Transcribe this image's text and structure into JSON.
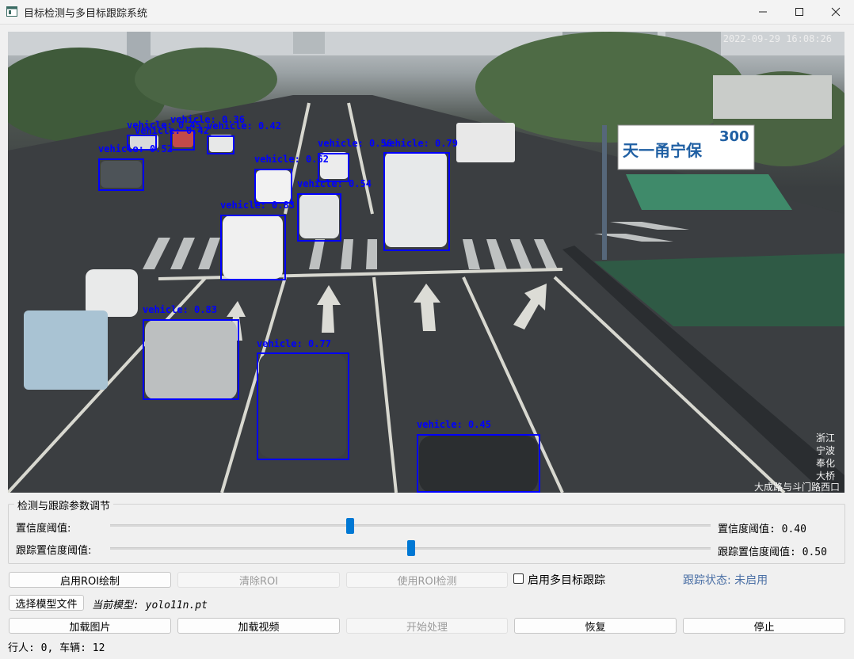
{
  "window": {
    "title": "目标检测与多目标跟踪系统",
    "icons": {
      "app": "app-window-icon",
      "minimize": "minimize-icon",
      "maximize": "maximize-icon",
      "close": "close-icon"
    }
  },
  "video": {
    "timestamp": "2022-09-29 16:08:26",
    "location_lines": [
      "浙江",
      "宁波",
      "奉化",
      "大桥",
      "大成路与斗门路西口"
    ],
    "billboard_text": "天一甬宁保",
    "billboard_number": "300",
    "detection_color": "#0000ff",
    "detections": [
      {
        "label": "vehicle: 0.36"
      },
      {
        "label": "vehicle: 0.45"
      },
      {
        "label": "vehicle: 0.42"
      },
      {
        "label": "vehicle: 0.42"
      },
      {
        "label": "vehicle: 0.52"
      },
      {
        "label": "vehicle: 0.62"
      },
      {
        "label": "vehicle: 0.56"
      },
      {
        "label": "vehicle: 0.79"
      },
      {
        "label": "vehicle: 0.54"
      },
      {
        "label": "vehicle: 0.83"
      },
      {
        "label": "vehicle: 0.83"
      },
      {
        "label": "vehicle: 0.77"
      },
      {
        "label": "vehicle: 0.45"
      }
    ]
  },
  "params": {
    "group_title": "检测与跟踪参数调节",
    "confidence": {
      "label": "置信度阈值:",
      "value_text": "置信度阈值: 0.40",
      "value": 0.4
    },
    "tracking_confidence": {
      "label": "跟踪置信度阈值:",
      "value_text": "跟踪置信度阈值: 0.50",
      "value": 0.5
    }
  },
  "roi": {
    "enable_label": "启用ROI绘制",
    "clear_label": "清除ROI",
    "use_label": "使用ROI检测",
    "tracking_checkbox_label": "启用多目标跟踪",
    "tracking_checked": false,
    "tracking_status": "跟踪状态: 未启用"
  },
  "model": {
    "select_label": "选择模型文件",
    "current_model": "当前模型: yolo11n.pt"
  },
  "actions": {
    "load_image": "加载图片",
    "load_video": "加载视频",
    "start": "开始处理",
    "resume": "恢复",
    "stop": "停止"
  },
  "status": {
    "counts": "行人: 0, 车辆: 12"
  },
  "colors": {
    "accent": "#0078d4",
    "status_text": "#4a6fa5",
    "disabled_text": "#9a9a9a"
  }
}
